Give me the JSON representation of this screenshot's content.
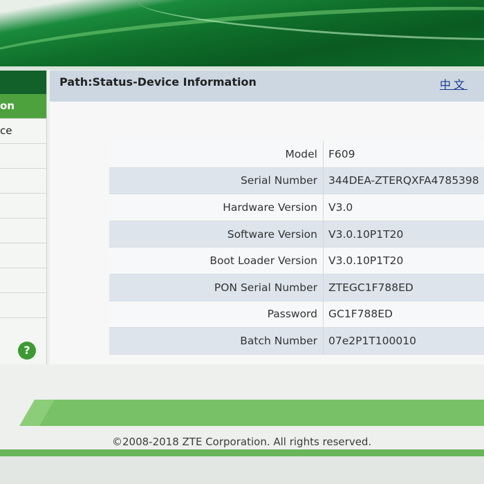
{
  "header": {
    "logo": ""
  },
  "sidebar": {
    "items": [
      {
        "label": "on",
        "active": true
      },
      {
        "label": "ce",
        "active": false
      },
      {
        "label": "",
        "active": false
      },
      {
        "label": "",
        "active": false
      },
      {
        "label": "",
        "active": false
      },
      {
        "label": "",
        "active": false
      },
      {
        "label": "",
        "active": false
      },
      {
        "label": "",
        "active": false
      },
      {
        "label": "",
        "active": false
      }
    ],
    "help_label": "?"
  },
  "main": {
    "path": "Path:Status-Device Information",
    "language_link": "中文"
  },
  "device_info": {
    "rows": [
      {
        "label": "Model",
        "value": "F609"
      },
      {
        "label": "Serial Number",
        "value": "344DEA-ZTERQXFA4785398"
      },
      {
        "label": "Hardware Version",
        "value": "V3.0"
      },
      {
        "label": "Software Version",
        "value": "V3.0.10P1T20"
      },
      {
        "label": "Boot Loader Version",
        "value": "V3.0.10P1T20"
      },
      {
        "label": "PON Serial Number",
        "value": "ZTEGC1F788ED"
      },
      {
        "label": "Password",
        "value": "GC1F788ED"
      },
      {
        "label": "Batch Number",
        "value": "07e2P1T100010"
      }
    ]
  },
  "footer": {
    "copyright": "©2008-2018 ZTE Corporation. All rights reserved."
  },
  "colors": {
    "header_green": "#0f6f2a",
    "active_menu": "#4ea23e",
    "path_bar": "#cdd7e2",
    "footer_green": "#8ccd7a"
  }
}
